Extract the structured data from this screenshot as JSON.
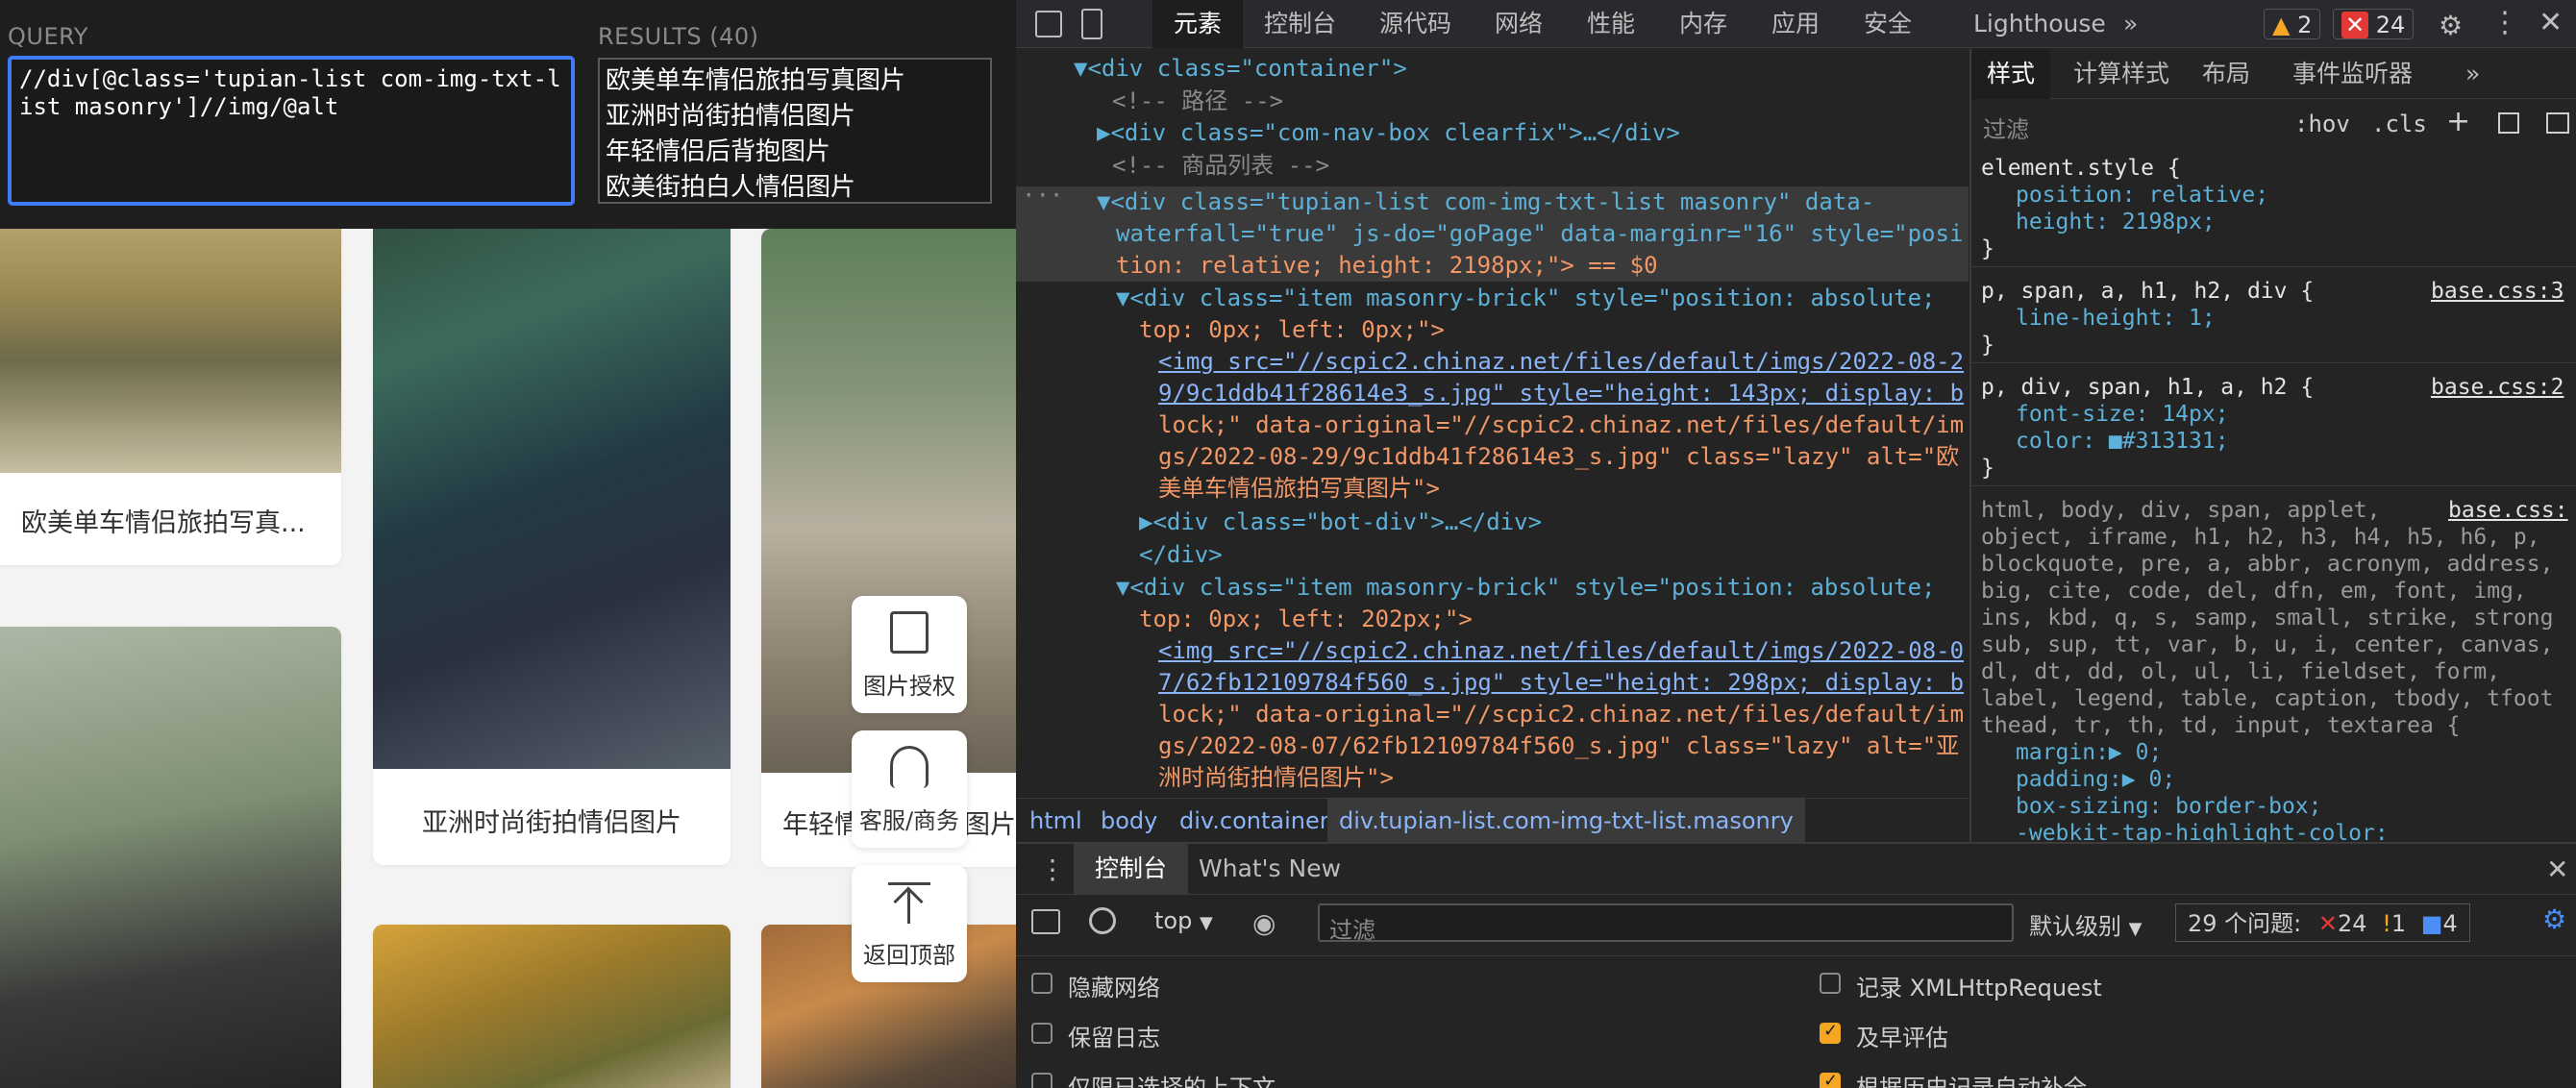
{
  "query_panel": {
    "query_title": "QUERY",
    "query_text": "//div[@class='tupian-list com-img-txt-list masonry']//img/@alt",
    "results_title": "RESULTS (40)",
    "results": [
      "欧美单车情侣旅拍写真图片",
      "亚洲时尚街拍情侣图片",
      "年轻情侣后背抱图片",
      "欧美街拍白人情侣图片"
    ]
  },
  "page": {
    "cards": [
      "欧美单车情侣旅拍写真...",
      "亚洲时尚街拍情侣图片",
      "年轻情侣后背抱图片"
    ],
    "float_buttons": {
      "license": "图片授权",
      "service": "客服/商务",
      "top": "返回顶部"
    }
  },
  "devtools": {
    "tabs": [
      "元素",
      "控制台",
      "源代码",
      "网络",
      "性能",
      "内存",
      "应用",
      "安全",
      "Lighthouse",
      "»"
    ],
    "warnings": "2",
    "errors": "24",
    "elements_lines": {
      "l1": "▼<div class=\"container\">",
      "l2": "<!-- 路径 -->",
      "l3": "▶<div class=\"com-nav-box clearfix\">…</div>",
      "l4": "<!-- 商品列表 -->",
      "l5a": "▼<div class=\"tupian-list com-img-txt-list masonry\" data-",
      "l5b": "waterfall=\"true\" js-do=\"goPage\" data-marginr=\"16\" style=\"posi",
      "l5c": "tion: relative; height: 2198px;\"> == $0",
      "l6a": "▼<div class=\"item masonry-brick\" style=\"position: absolute;",
      "l6b": "top: 0px; left: 0px;\">",
      "l7a": "<img src=\"//scpic2.chinaz.net/files/default/imgs/2022-08-2",
      "l7b": "9/9c1ddb41f28614e3_s.jpg\" style=\"height: 143px; display: b",
      "l7c": "lock;\" data-original=\"//scpic2.chinaz.net/files/default/im",
      "l7d": "gs/2022-08-29/9c1ddb41f28614e3_s.jpg\" class=\"lazy\" alt=\"欧",
      "l7e": "美单车情侣旅拍写真图片\">",
      "l8": "▶<div class=\"bot-div\">…</div>",
      "l9": "</div>",
      "l10a": "▼<div class=\"item masonry-brick\" style=\"position: absolute;",
      "l10b": "top: 0px; left: 202px;\">",
      "l11a": "<img src=\"//scpic2.chinaz.net/files/default/imgs/2022-08-0",
      "l11b": "7/62fb12109784f560_s.jpg\" style=\"height: 298px; display: b",
      "l11c": "lock;\" data-original=\"//scpic2.chinaz.net/files/default/im",
      "l11d": "gs/2022-08-07/62fb12109784f560_s.jpg\" class=\"lazy\" alt=\"亚",
      "l11e": "洲时尚街拍情侣图片\">"
    },
    "breadcrumbs": [
      "html",
      "body",
      "div.container",
      "div.tupian-list.com-img-txt-list.masonry"
    ],
    "styles": {
      "tabs": [
        "样式",
        "计算样式",
        "布局",
        "事件监听器",
        "»"
      ],
      "filter_placeholder": "过滤",
      "hov": ":hov",
      "cls": ".cls",
      "rule1_sel": "element.style {",
      "rule1_p1": "position: relative;",
      "rule1_p2": "height: 2198px;",
      "rule2_sel": "p, span, a, h1, h2, div {",
      "rule2_src": "base.css:3",
      "rule2_p1": "line-height: 1;",
      "rule3_sel": "p, div, span, h1, a, h2 {",
      "rule3_src": "base.css:2",
      "rule3_p1": "font-size: 14px;",
      "rule3_p2": "color: ■#313131;",
      "rule4_l1": "html, body, div, span, applet,",
      "rule4_src": "base.css:",
      "rule4_l2": "object, iframe, h1, h2, h3, h4, h5, h6, p,",
      "rule4_l3": "blockquote, pre, a, abbr, acronym, address,",
      "rule4_l4": "big, cite, code, del, dfn, em, font, img,",
      "rule4_l5": "ins, kbd, q, s, samp, small, strike, strong",
      "rule4_l6": "sub, sup, tt, var, b, u, i, center, canvas,",
      "rule4_l7": "dl, dt, dd, ol, ul, li, fieldset, form,",
      "rule4_l8": "label, legend, table, caption, tbody, tfoot",
      "rule4_l9": "thead, tr, th, td, input, textarea {",
      "rule4_p1": "margin:▶ 0;",
      "rule4_p2": "padding:▶ 0;",
      "rule4_p3": "box-sizing: border-box;",
      "rule4_p4": "-webkit-tap-highlight-color:"
    },
    "console": {
      "tabs": [
        "控制台",
        "What's New"
      ],
      "context": "top",
      "filter_placeholder": "过滤",
      "level": "默认级别",
      "issues_label": "29 个问题:",
      "issue_errors": "24",
      "issue_warnings": "1",
      "issue_info": "4",
      "settings_left": [
        "隐藏网络",
        "保留日志",
        "仅限已选择的上下文"
      ],
      "settings_right": [
        "记录 XMLHttpRequest",
        "及早评估",
        "根据历史记录自动补全"
      ],
      "checked_right": [
        false,
        true,
        true
      ]
    }
  }
}
